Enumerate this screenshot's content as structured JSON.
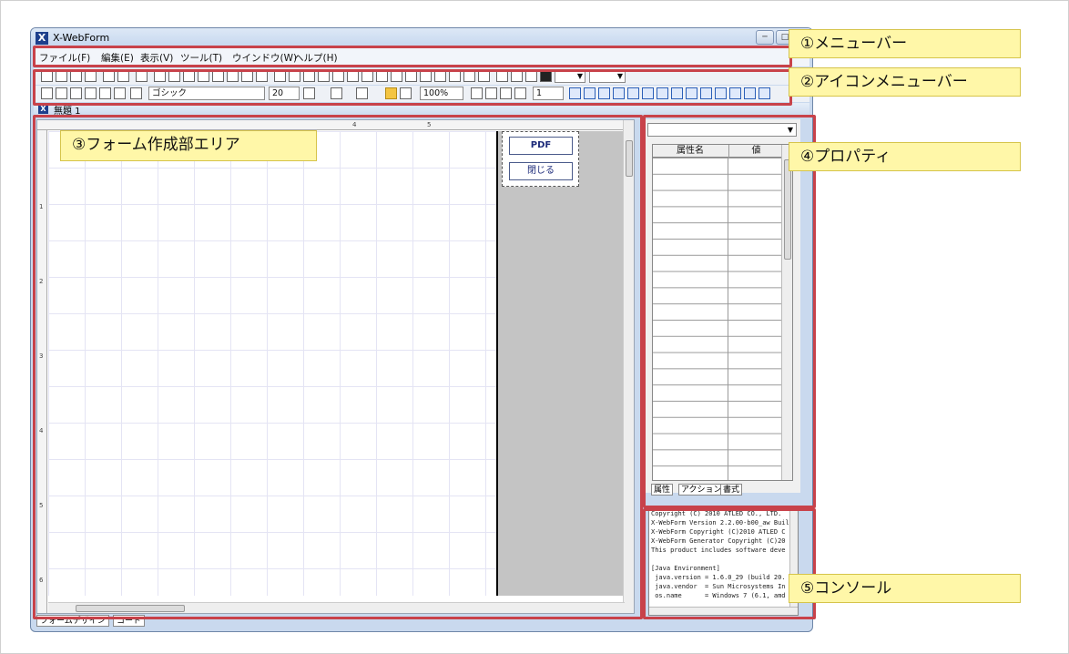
{
  "window": {
    "title": "X-WebForm",
    "app_icon": "X",
    "controls": {
      "minimize": "─",
      "maximize": "□",
      "close": "X"
    }
  },
  "menubar": {
    "items": [
      "ファイル(F)",
      "編集(E)",
      "表示(V)",
      "ツール(T)",
      "ウインドウ(W)",
      "ヘルプ(H)"
    ]
  },
  "toolbar": {
    "font_name": "ゴシック",
    "font_size": "20",
    "zoom": "100%",
    "page": "1"
  },
  "document": {
    "tab_title": "無題 1",
    "ruler_marks": [
      "4",
      "5",
      "1",
      "2",
      "3",
      "4",
      "5",
      "6"
    ]
  },
  "form": {
    "pdf_button": "PDF",
    "close_button": "閉じる"
  },
  "bottom_tabs": [
    "フォームデザイン",
    "コード"
  ],
  "properties": {
    "col_name": "属性名",
    "col_value": "値",
    "tabs": [
      "属性",
      "アクション",
      "書式"
    ]
  },
  "console": {
    "lines": [
      "Copyright (C) 2010 ATLED CO., LTD.",
      "X-WebForm Version 2.2.00-b00_aw Build",
      "X-WebForm Copyright (C)2010 ATLED C",
      "X-WebForm Generator Copyright (C)20",
      "This product includes software deve",
      "",
      "[Java Environment]",
      " java.version = 1.6.0_29 (build 20.",
      " java.vendor  = Sun Microsystems In",
      " os.name      = Windows 7 (6.1, amd"
    ]
  },
  "callouts": {
    "menubar": "①メニューバー",
    "iconmenu": "②アイコンメニューバー",
    "form_area": "③フォーム作成部エリア",
    "properties": "④プロパティ",
    "console": "⑤コンソール"
  },
  "colors": {
    "callout_bg": "#fff7a8",
    "region_border": "#c8424a",
    "window_frame": "#c9d9ee"
  }
}
